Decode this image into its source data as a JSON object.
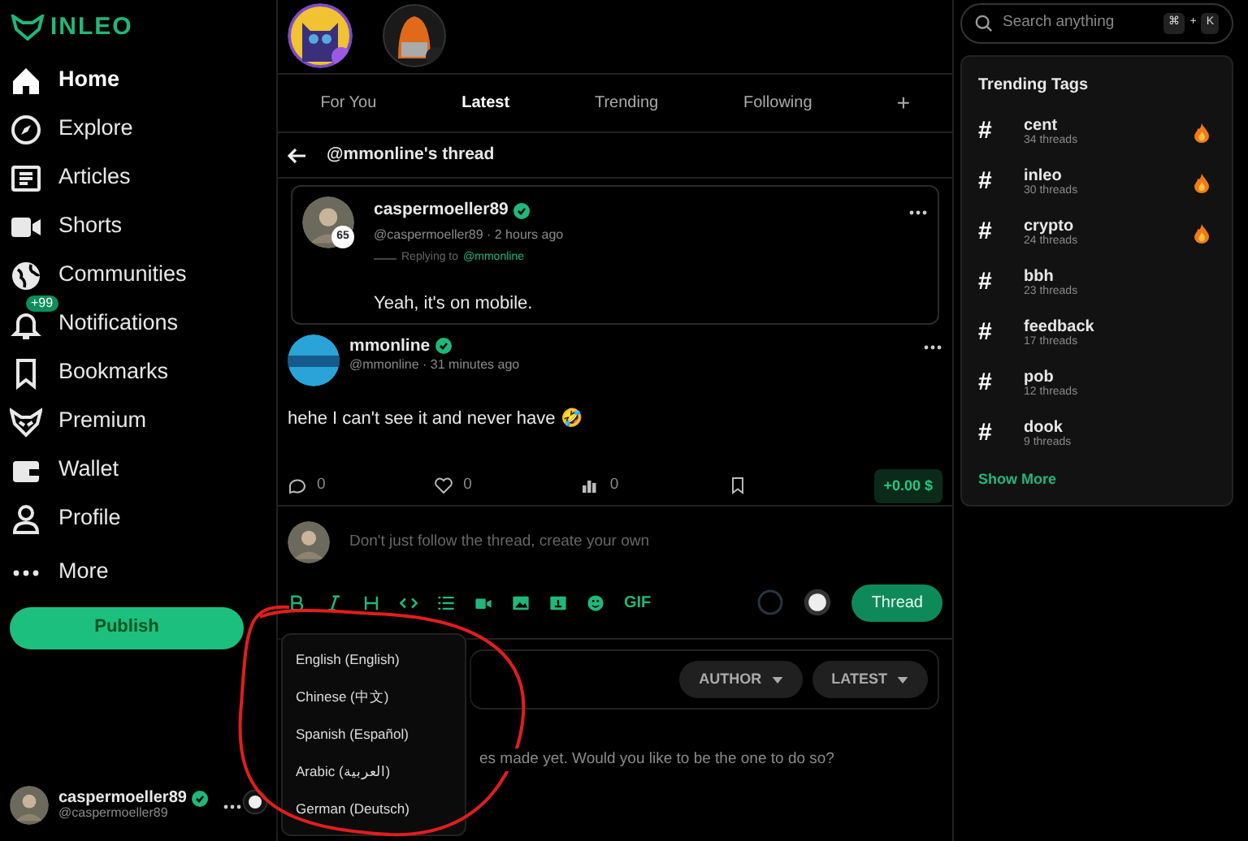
{
  "logo": {
    "text": "INLEO"
  },
  "nav": [
    {
      "kind": "home",
      "label": "Home",
      "selected": true
    },
    {
      "kind": "explore",
      "label": "Explore",
      "selected": false
    },
    {
      "kind": "articles",
      "label": "Articles",
      "selected": false
    },
    {
      "kind": "shorts",
      "label": "Shorts",
      "selected": false
    },
    {
      "kind": "communities",
      "label": "Communities",
      "selected": false
    },
    {
      "kind": "notifications",
      "label": "Notifications",
      "selected": false,
      "badge": "+99"
    },
    {
      "kind": "bookmarks",
      "label": "Bookmarks",
      "selected": false
    },
    {
      "kind": "premium",
      "label": "Premium",
      "selected": false
    },
    {
      "kind": "wallet",
      "label": "Wallet",
      "selected": false
    },
    {
      "kind": "profile",
      "label": "Profile",
      "selected": false
    },
    {
      "kind": "more",
      "label": "More",
      "selected": false
    }
  ],
  "publish": "Publish",
  "account": {
    "name": "caspermoeller89",
    "handle": "@caspermoeller89",
    "verified": true
  },
  "feed_tabs": [
    {
      "label": "For You",
      "selected": false
    },
    {
      "label": "Latest",
      "selected": true
    },
    {
      "label": "Trending",
      "selected": false
    },
    {
      "label": "Following",
      "selected": false
    }
  ],
  "add_tab": "+",
  "thread": {
    "title": "@mmonline's thread"
  },
  "parent_reply": {
    "name": "caspermoeller89",
    "verified": true,
    "meta": "@caspermoeller89 · 2 hours ago",
    "level_badge": "65",
    "replying_prefix": "Replying to",
    "replying_to": "@mmonline",
    "text": "Yeah, it's on mobile."
  },
  "post": {
    "name": "mmonline",
    "verified": true,
    "meta": "@mmonline · 31 minutes ago",
    "text": "hehe I can't see it and never have 🤣",
    "stats": [
      {
        "kind": "comments",
        "count": "0"
      },
      {
        "kind": "likes",
        "count": "0"
      },
      {
        "kind": "views",
        "count": "0"
      },
      {
        "kind": "bookmark"
      }
    ],
    "payout": "+0.00 $"
  },
  "composer": {
    "placeholder": "Don't just follow the thread, create your own",
    "tools": [
      {
        "kind": "bold"
      },
      {
        "kind": "italic"
      },
      {
        "kind": "heading"
      },
      {
        "kind": "code"
      },
      {
        "kind": "list"
      },
      {
        "kind": "video"
      },
      {
        "kind": "image"
      },
      {
        "kind": "upload"
      },
      {
        "kind": "emoji"
      },
      {
        "kind": "gif",
        "label": "GIF"
      }
    ],
    "submit": "Thread"
  },
  "filters": [
    "AUTHOR",
    "LATEST"
  ],
  "empty_text": "es made yet. Would you like to be the one to do so?",
  "language_menu": [
    "English (English)",
    "Chinese (中文)",
    "Spanish (Español)",
    "Arabic (العربية)",
    "German (Deutsch)"
  ],
  "search": {
    "placeholder": "Search anything",
    "keys": [
      "⌘",
      "+",
      "K"
    ]
  },
  "trending": {
    "title": "Trending Tags",
    "tags": [
      {
        "symbol": "#",
        "name": "cent",
        "count": "34 threads",
        "hot": true
      },
      {
        "symbol": "#",
        "name": "inleo",
        "count": "30 threads",
        "hot": true
      },
      {
        "symbol": "#",
        "name": "crypto",
        "count": "24 threads",
        "hot": true
      },
      {
        "symbol": "#",
        "name": "bbh",
        "count": "23 threads",
        "hot": false
      },
      {
        "symbol": "#",
        "name": "feedback",
        "count": "17 threads",
        "hot": false
      },
      {
        "symbol": "#",
        "name": "pob",
        "count": "12 threads",
        "hot": false
      },
      {
        "symbol": "#",
        "name": "dook",
        "count": "9 threads",
        "hot": false
      }
    ],
    "more": "Show More"
  }
}
